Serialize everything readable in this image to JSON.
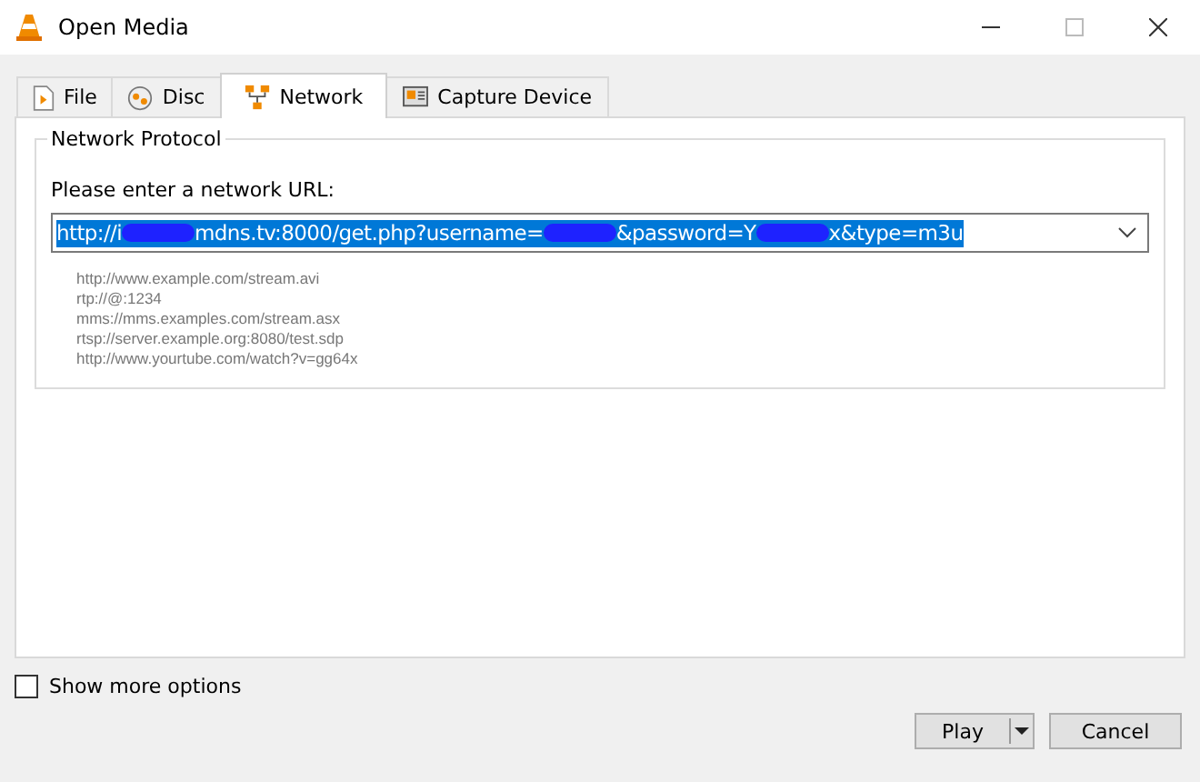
{
  "window": {
    "title": "Open Media"
  },
  "tabs": [
    {
      "label": "File",
      "selected": false,
      "kind": "file"
    },
    {
      "label": "Disc",
      "selected": false,
      "kind": "disc"
    },
    {
      "label": "Network",
      "selected": true,
      "kind": "network"
    },
    {
      "label": "Capture Device",
      "selected": false,
      "kind": "capture"
    }
  ],
  "group": {
    "title": "Network Protocol",
    "prompt": "Please enter a network URL:",
    "url_segments": [
      {
        "kind": "text",
        "text": "http://i"
      },
      {
        "kind": "redaction"
      },
      {
        "kind": "text",
        "text": "mdns.tv:8000/get.php?username="
      },
      {
        "kind": "redaction"
      },
      {
        "kind": "text",
        "text": "&password=Y"
      },
      {
        "kind": "redaction"
      },
      {
        "kind": "text",
        "text": "x&type=m3u"
      }
    ],
    "examples": [
      "http://www.example.com/stream.avi",
      "rtp://@:1234",
      "mms://mms.examples.com/stream.asx",
      "rtsp://server.example.org:8080/test.sdp",
      "http://www.yourtube.com/watch?v=gg64x"
    ]
  },
  "show_more_options": {
    "label": "Show more options",
    "checked": false
  },
  "buttons": {
    "play": "Play",
    "cancel": "Cancel"
  }
}
